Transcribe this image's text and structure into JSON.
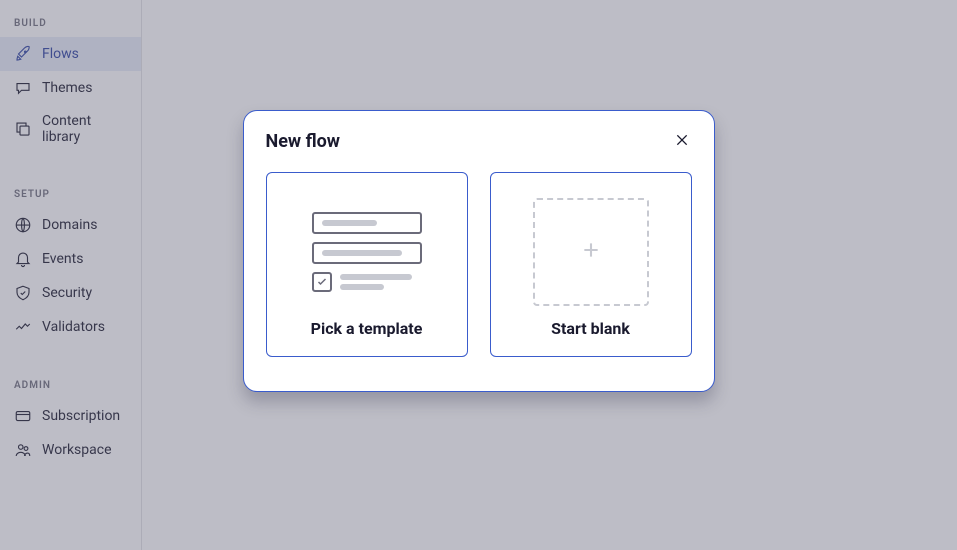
{
  "sidebar": {
    "sections": [
      {
        "header": "BUILD",
        "items": [
          {
            "label": "Flows",
            "icon": "rocket-icon",
            "active": true
          },
          {
            "label": "Themes",
            "icon": "chat-icon",
            "active": false
          },
          {
            "label": "Content library",
            "icon": "copy-icon",
            "active": false
          }
        ]
      },
      {
        "header": "SETUP",
        "items": [
          {
            "label": "Domains",
            "icon": "globe-icon",
            "active": false
          },
          {
            "label": "Events",
            "icon": "bell-icon",
            "active": false
          },
          {
            "label": "Security",
            "icon": "shield-icon",
            "active": false
          },
          {
            "label": "Validators",
            "icon": "chart-icon",
            "active": false
          }
        ]
      },
      {
        "header": "ADMIN",
        "items": [
          {
            "label": "Subscription",
            "icon": "card-icon",
            "active": false
          },
          {
            "label": "Workspace",
            "icon": "users-icon",
            "active": false
          }
        ]
      }
    ]
  },
  "modal": {
    "title": "New flow",
    "options": [
      {
        "label": "Pick a template"
      },
      {
        "label": "Start blank"
      }
    ]
  }
}
